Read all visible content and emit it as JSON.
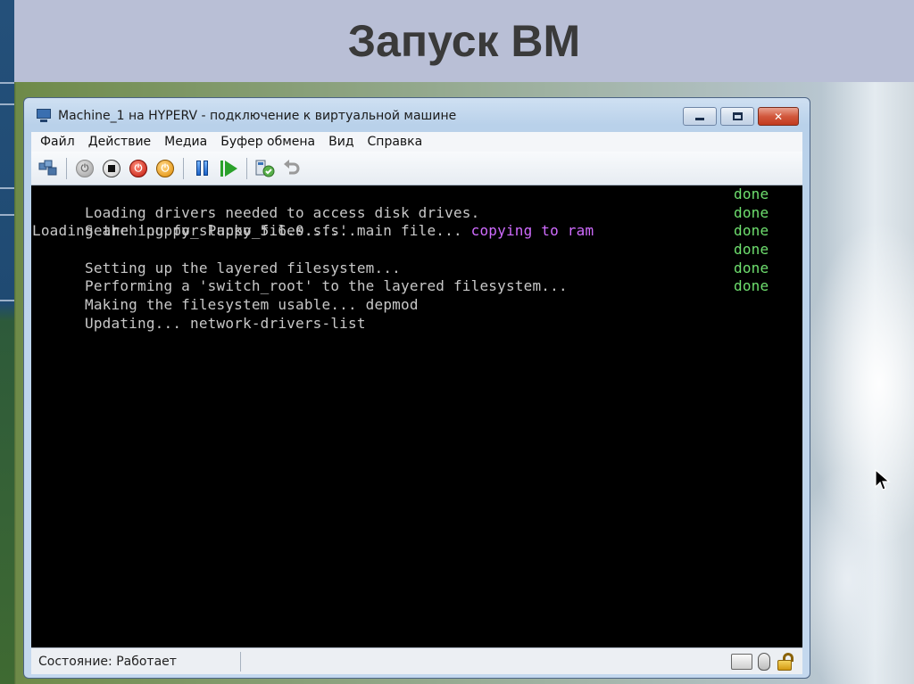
{
  "slide": {
    "title": "Запуск ВМ"
  },
  "window": {
    "title": "Machine_1 на HYPERV - подключение к виртуальной машине",
    "menu": [
      "Файл",
      "Действие",
      "Медиа",
      "Буфер обмена",
      "Вид",
      "Справка"
    ]
  },
  "toolbar": {
    "icons": [
      "ctrl-alt-del-icon",
      "power-on-icon",
      "stop-icon",
      "shutdown-icon",
      "save-icon",
      "pause-icon",
      "resume-icon",
      "snapshot-icon",
      "revert-icon"
    ]
  },
  "console": {
    "lines": [
      {
        "text": "Loading drivers needed to access disk drives.",
        "status": "done"
      },
      {
        "text": "Searching for Puppy files......",
        "status": "done"
      },
      {
        "text": "Loading the 'puppy_slacko_5.6.0.sfs' main file... ",
        "highlight": "copying to ram",
        "status": "done"
      },
      {
        "text": "Setting up the layered filesystem...",
        "status": "done"
      },
      {
        "text": "Performing a 'switch_root' to the layered filesystem...",
        "status": "done"
      },
      {
        "text": "Making the filesystem usable... depmod",
        "status": "done"
      },
      {
        "text": "Updating... network-drivers-list",
        "status": ""
      }
    ]
  },
  "statusbar": {
    "status": "Состояние: Работает"
  },
  "colors": {
    "done": "#6fe06f",
    "highlight": "#d06cff",
    "console_bg": "#000000"
  }
}
